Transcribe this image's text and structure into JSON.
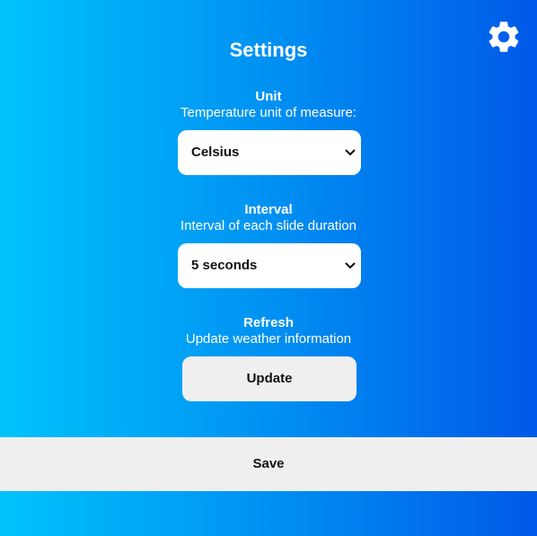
{
  "header": {
    "title": "Settings",
    "settings_icon": "gear-icon"
  },
  "unit": {
    "heading": "Unit",
    "description": "Temperature unit of measure:",
    "selected": "Celsius"
  },
  "interval": {
    "heading": "Interval",
    "description": "Interval of each slide duration",
    "selected": "5 seconds"
  },
  "refresh": {
    "heading": "Refresh",
    "description": "Update weather information",
    "button_label": "Update"
  },
  "footer": {
    "save_label": "Save"
  },
  "colors": {
    "gradient_start": "#00c3fb",
    "gradient_end": "#0059e8",
    "button_background": "#efefef",
    "text": "#ffffff"
  }
}
